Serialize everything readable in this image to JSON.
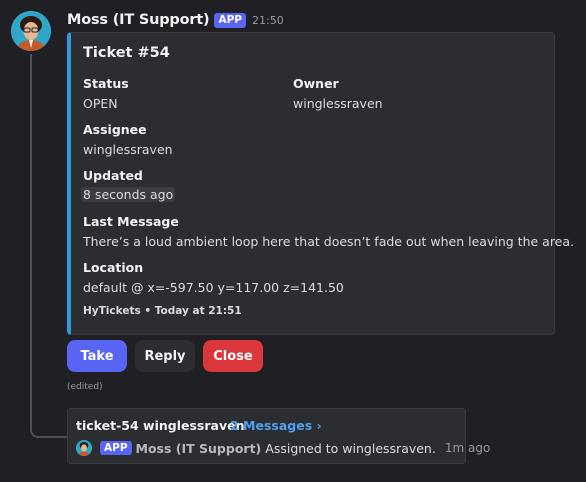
{
  "message": {
    "author": "Moss (IT Support)",
    "app_tag": "APP",
    "time": "21:50",
    "edited": "(edited)"
  },
  "embed": {
    "accent_color": "#3498db",
    "title": "Ticket #54",
    "fields": {
      "status": {
        "name": "Status",
        "value": "OPEN"
      },
      "owner": {
        "name": "Owner",
        "value": "winglessraven"
      },
      "assignee": {
        "name": "Assignee",
        "value": "winglessraven"
      },
      "updated": {
        "name": "Updated",
        "value": "8 seconds ago"
      },
      "last_message": {
        "name": "Last Message",
        "value": "There’s a loud ambient loop here that doesn’t fade out when leaving the area."
      },
      "location": {
        "name": "Location",
        "value": "default @ x=-597.50 y=117.00 z=141.50"
      }
    },
    "footer": "HyTickets • Today at 21:51"
  },
  "buttons": {
    "take": "Take",
    "reply": "Reply",
    "close": "Close"
  },
  "thread": {
    "title": "ticket-54 winglessraven",
    "link": "2 Messages ›",
    "app_tag": "APP",
    "author": "Moss (IT Support)",
    "text": "Assigned to winglessraven.",
    "time": "1m ago"
  },
  "icons": {
    "avatar": "avatar-icon",
    "thread_avatar": "mini-avatar-icon"
  },
  "colors": {
    "brand": "#5865f2",
    "danger": "#da373c",
    "link": "#4ea1f0"
  }
}
